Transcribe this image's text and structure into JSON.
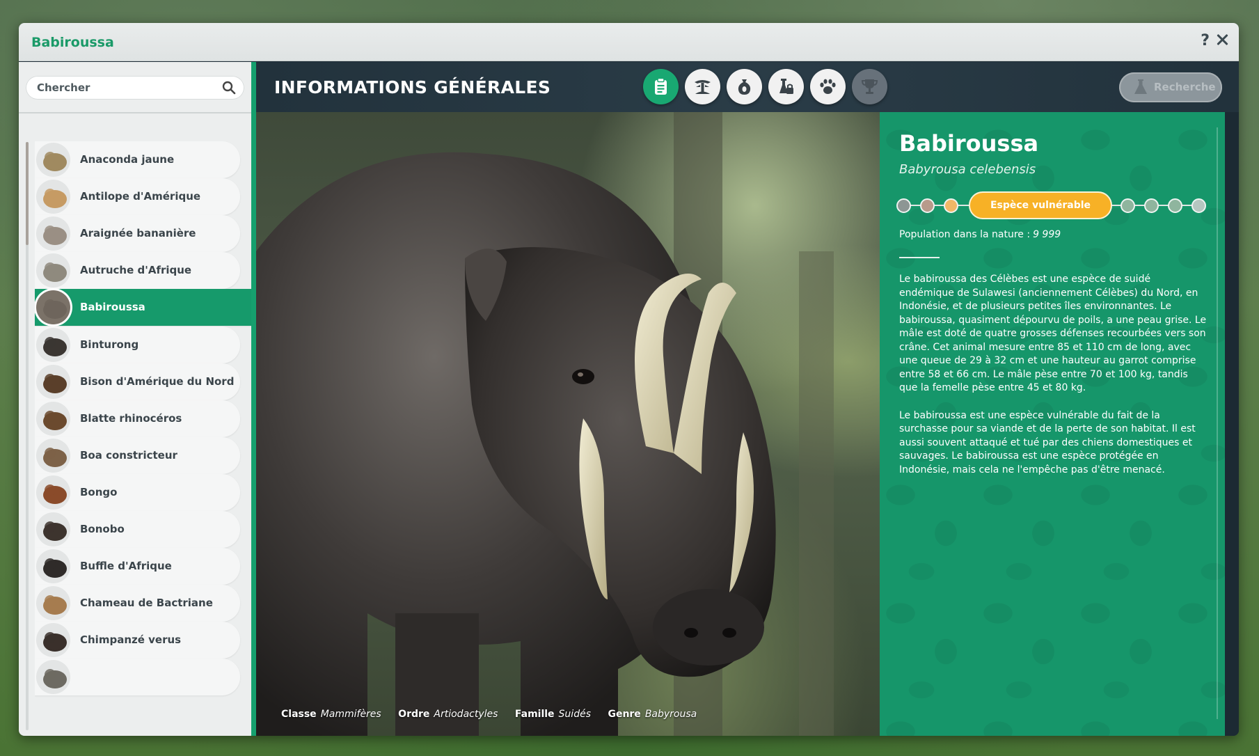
{
  "window": {
    "title": "Babiroussa",
    "help_label": "?"
  },
  "sidebar": {
    "search_placeholder": "Chercher",
    "items": [
      {
        "label": "Anaconda jaune",
        "thumb_color": "#a08a60"
      },
      {
        "label": "Antilope d'Amérique",
        "thumb_color": "#c69b64"
      },
      {
        "label": "Araignée bananière",
        "thumb_color": "#9a8f84"
      },
      {
        "label": "Autruche d'Afrique",
        "thumb_color": "#8f8a7e"
      },
      {
        "label": "Babiroussa",
        "thumb_color": "#6e655c"
      },
      {
        "label": "Binturong",
        "thumb_color": "#3b3632"
      },
      {
        "label": "Bison d'Amérique du Nord",
        "thumb_color": "#5a3f2a"
      },
      {
        "label": "Blatte rhinocéros",
        "thumb_color": "#6b4a2e"
      },
      {
        "label": "Boa constricteur",
        "thumb_color": "#7d6248"
      },
      {
        "label": "Bongo",
        "thumb_color": "#8a4b2a"
      },
      {
        "label": "Bonobo",
        "thumb_color": "#3d342e"
      },
      {
        "label": "Buffle d'Afrique",
        "thumb_color": "#2f2b29"
      },
      {
        "label": "Chameau de Bactriane",
        "thumb_color": "#a67c4f"
      },
      {
        "label": "Chimpanzé verus",
        "thumb_color": "#3a302b"
      },
      {
        "label": "",
        "thumb_color": "#6d6a62"
      }
    ]
  },
  "main": {
    "section_title": "INFORMATIONS GÉNÉRALES",
    "research_label": "Recherche",
    "tabs": [
      {
        "icon": "clipboard-icon",
        "state": "active"
      },
      {
        "icon": "habitat-icon",
        "state": "normal"
      },
      {
        "icon": "food-sack-icon",
        "state": "normal"
      },
      {
        "icon": "enrichment-icon",
        "state": "normal"
      },
      {
        "icon": "paw-icon",
        "state": "normal"
      },
      {
        "icon": "trophy-icon",
        "state": "disabled"
      }
    ]
  },
  "photo": {
    "classe_label": "Classe",
    "classe_value": "Mammifères",
    "ordre_label": "Ordre",
    "ordre_value": "Artiodactyles",
    "famille_label": "Famille",
    "famille_value": "Suidés",
    "genre_label": "Genre",
    "genre_value": "Babyrousa"
  },
  "info": {
    "name": "Babiroussa",
    "latin": "Babyrousa celebensis",
    "status_label": "Espèce vulnérable",
    "status_dots_left": [
      "#8d9694",
      "#b89a8b",
      "#f1b767"
    ],
    "status_dots_right": [
      "#8fb59e",
      "#8fb59e",
      "#8fb59e",
      "#b6c6c0"
    ],
    "population_label": "Population dans la nature :",
    "population_value": "9 999",
    "paragraph1": "Le babiroussa des Célèbes est une espèce de suidé endémique de Sulawesi (anciennement Célèbes) du Nord, en Indonésie, et de plusieurs petites îles environnantes. Le babiroussa, quasiment dépourvu de poils, a une peau grise. Le mâle est doté de quatre grosses défenses recourbées vers son crâne. Cet animal mesure entre 85 et 110 cm de long, avec une queue de 29 à 32 cm et une hauteur au garrot comprise entre 58 et 66 cm. Le mâle pèse entre 70 et 100 kg, tandis que la femelle pèse entre 45 et 80 kg.",
    "paragraph2": "Le babiroussa est une espèce vulnérable du fait de la surchasse pour sa viande et de la perte de son habitat. Il est aussi souvent attaqué et tué par des chiens domestiques et sauvages. Le babiroussa est une espèce protégée en Indonésie, mais cela ne l'empêche pas d'être menacé."
  },
  "colors": {
    "accent": "#169a6b",
    "status_orange": "#f7b126",
    "header_dark": "#22323c"
  }
}
